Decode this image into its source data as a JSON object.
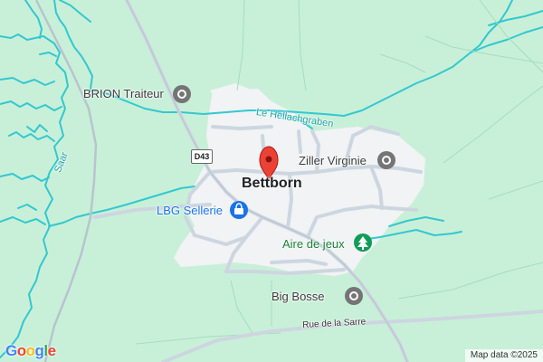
{
  "map": {
    "colors": {
      "land": "#c8f0d8",
      "built_area": "#f1f3f4",
      "water": "#33c8d0",
      "road": "#cdd6e0",
      "rail": "#b8c4ce",
      "marker": "#ea4335",
      "poi_gray": "#757575",
      "poi_blue": "#1a73e8",
      "poi_green": "#0f9d58"
    },
    "town": "Bettborn",
    "pois": [
      {
        "name": "BRION Traiteur",
        "icon": "gray-pin-icon"
      },
      {
        "name": "Ziller Virginie",
        "icon": "gray-pin-icon"
      },
      {
        "name": "LBG Sellerie",
        "icon": "shopping-bag-icon"
      },
      {
        "name": "Aire de jeux",
        "icon": "tree-icon"
      },
      {
        "name": "Big Bosse",
        "icon": "gray-pin-icon"
      }
    ],
    "waterways": [
      {
        "name": "Le Hellachgraben"
      },
      {
        "name": "Saar"
      }
    ],
    "roads": [
      {
        "shield": "D43"
      },
      {
        "name": "Rue de la Sarre"
      }
    ],
    "marker_icon": "location-marker-icon",
    "logo": "Google",
    "attribution": "Map data ©2025"
  }
}
